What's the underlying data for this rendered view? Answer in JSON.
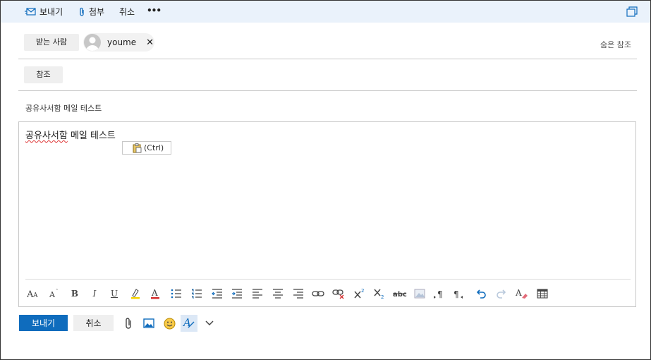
{
  "toolbar": {
    "send_label": "보내기",
    "attach_label": "첨부",
    "discard_label": "취소",
    "more_label": "•••"
  },
  "header": {
    "to_label": "받는 사람",
    "recipient_name": "youme",
    "remove_label": "✕",
    "cc_label": "참조",
    "bcc_label": "숨은 참조"
  },
  "subject": "공유사서함 메일 테스트",
  "body": {
    "text": "공유사서함",
    "text_rest": " 메일 테스트",
    "paste_options_label": "(Ctrl)"
  },
  "bottom": {
    "send_label": "보내기",
    "discard_label": "취소"
  },
  "colors": {
    "accent": "#0f6cbd",
    "topbar_bg": "#eaf2fb"
  }
}
